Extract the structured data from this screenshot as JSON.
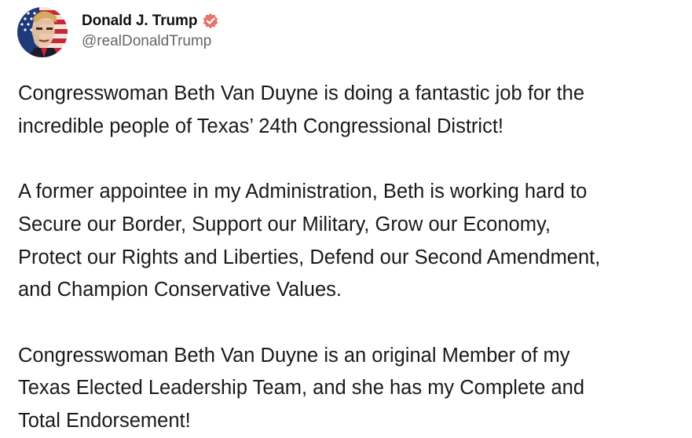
{
  "post": {
    "author": {
      "display_name": "Donald J. Trump",
      "handle": "@realDonaldTrump",
      "verified": true,
      "avatar_icon": "flag-portrait-avatar",
      "verified_icon": "verified-badge-icon"
    },
    "paragraphs": [
      "Congresswoman Beth Van Duyne is doing a fantastic job for the\nincredible people of Texas’ 24th Congressional District!",
      "A former appointee in my Administration, Beth is working hard to\nSecure our Border, Support our Military, Grow our Economy,\nProtect our Rights and Liberties, Defend our Second Amendment,\nand Champion Conservative Values.",
      "Congresswoman Beth Van Duyne is an original Member of my\nTexas Elected Leadership Team, and she has my Complete and\nTotal Endorsement!"
    ]
  },
  "colors": {
    "verified_badge": "#e8736a",
    "handle_text": "#666666",
    "body_text": "#1a1a1a"
  }
}
